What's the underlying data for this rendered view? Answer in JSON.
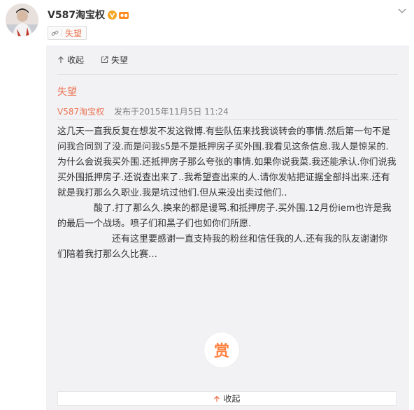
{
  "header": {
    "username": "V587淘宝权",
    "verified_icon": "verified-v-icon",
    "level_icon": "level-badge-icon",
    "tag_label": "失望"
  },
  "toolbar": {
    "collapse_label": "收起",
    "view_label": "失望"
  },
  "article": {
    "title": "失望",
    "author": "V587淘宝权",
    "published": "发布于2015年11月5日 11:24",
    "paragraphs": [
      "这几天一直我反复在想发不发这微博.有些队伍来找我谈转会的事情.然后第一句不是问我合同到了没.而是问我s5是不是抵押房子买外围.我看见这条信息.我人是惊呆的.为什么会说我买外围.还抵押房子那么夸张的事情.如果你说我菜.我还能承认.你们说我买外围抵押房子.还说查出来了..我希望查出来的人.请你发帖把证据全部抖出来.还有就是我打那么久职业.我是坑过他们.但从来没出卖过他们..",
      "酸了.打了那么久.换来的都是谩骂.和抵押房子.买外围.12月份iem也许是我的最后一个战场。喷子们和黑子们也如你们所愿.",
      "还有这里要感谢一直支持我的粉丝和信任我的人.还有我的队友谢谢你们陪着我打那么久比赛…"
    ],
    "reward_label": "赏"
  },
  "footer": {
    "collapse_label": "收起"
  },
  "colors": {
    "accent": "#eb7350",
    "reward": "#ff8140",
    "panel_bg": "#f2f2f5"
  }
}
